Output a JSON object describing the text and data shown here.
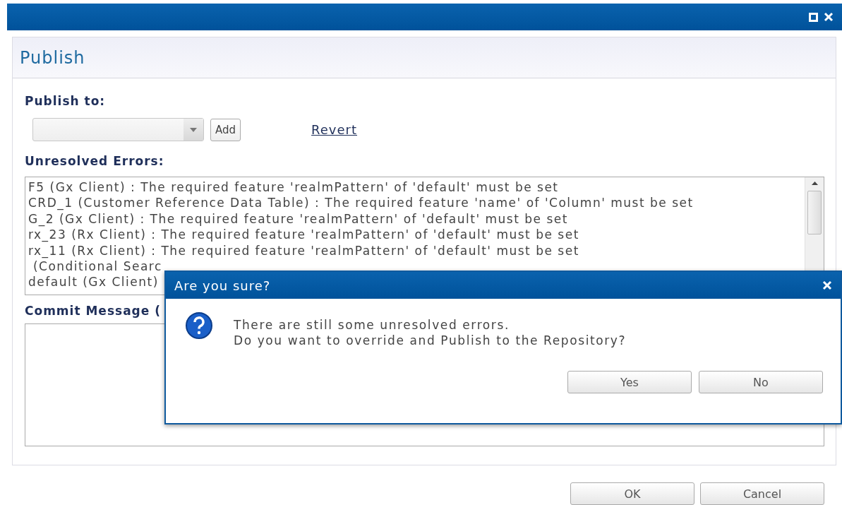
{
  "window": {
    "title": "Publish"
  },
  "publish_to": {
    "label": "Publish to:",
    "add_button": "Add",
    "revert_link": "Revert"
  },
  "errors": {
    "label": "Unresolved Errors:",
    "lines": [
      "F5 (Gx Client) : The required feature 'realmPattern' of 'default' must be set",
      "CRD_1 (Customer Reference Data Table) : The required feature 'name' of 'Column' must be set",
      "G_2 (Gx Client) : The required feature 'realmPattern' of 'default' must be set",
      "rx_23 (Rx Client) : The required feature 'realmPattern' of 'default' must be set",
      "rx_11 (Rx Client) : The required feature 'realmPattern' of 'default' must be set",
      " (Conditional Searc",
      "default (Gx Client)"
    ]
  },
  "commit": {
    "label": "Commit Message ("
  },
  "buttons": [
    "OK",
    "Cancel"
  ],
  "confirm_dialog": {
    "title": "Are you sure?",
    "message_lines": [
      "There are still some unresolved errors.",
      "Do you want to override and Publish to the Repository?"
    ],
    "buttons": [
      "Yes",
      "No"
    ]
  }
}
